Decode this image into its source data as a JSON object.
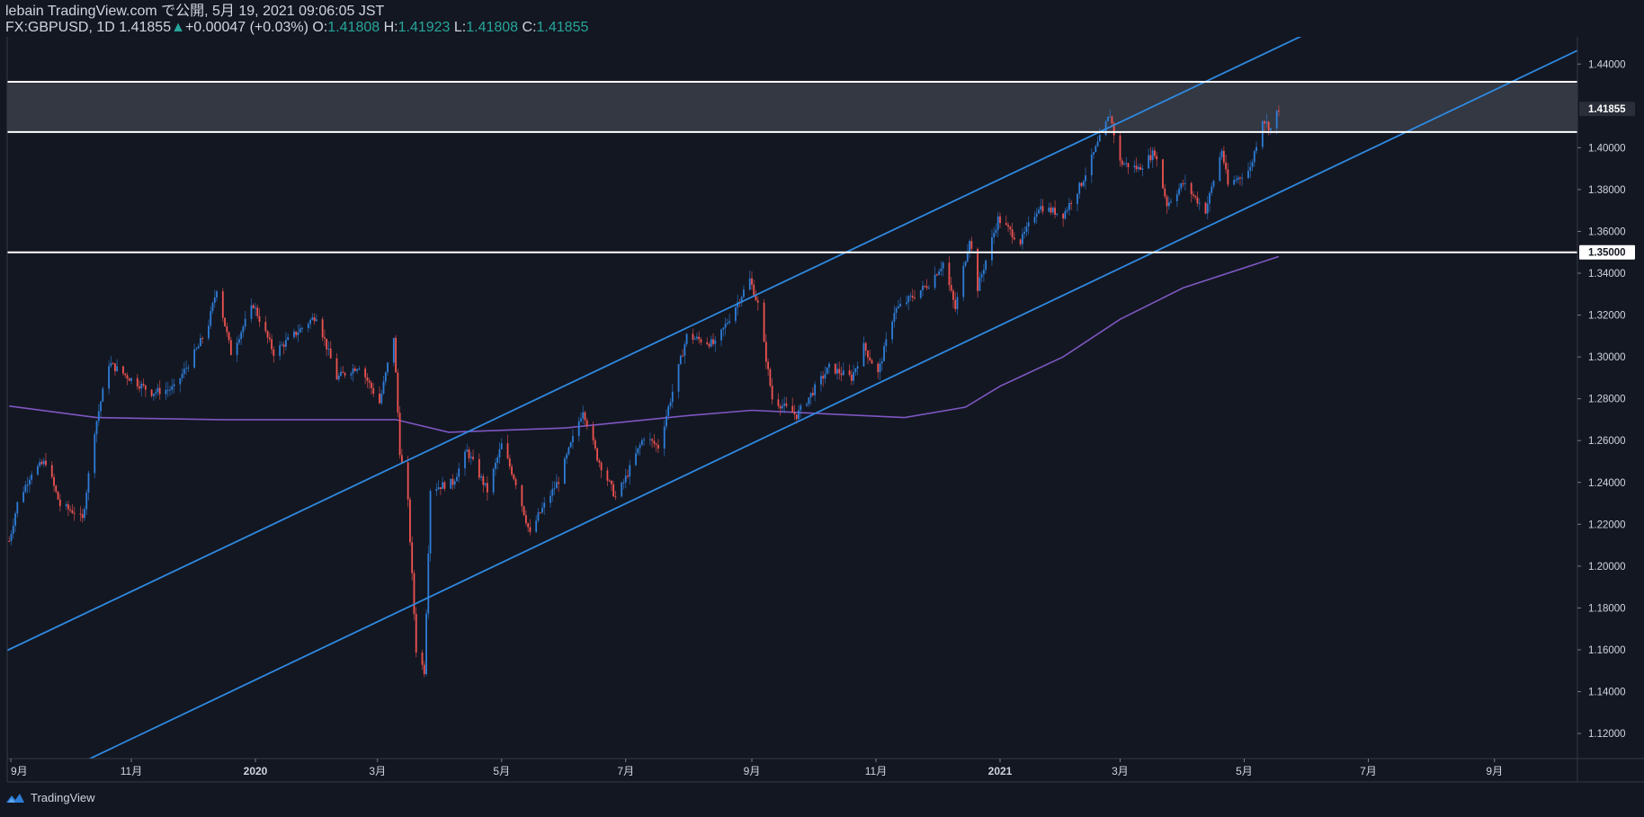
{
  "header": {
    "line1": "lebain TradingView.com で公開, 5月 19, 2021 09:06:05 JST",
    "symbol": "FX:GBPUSD, 1D",
    "last": "1.41855",
    "change": "+0.00047 (+0.03%)",
    "o_label": "O:",
    "o_value": "1.41808",
    "h_label": "H:",
    "h_value": "1.41923",
    "l_label": "L:",
    "l_value": "1.41808",
    "c_label": "C:",
    "c_value": "1.41855"
  },
  "footer": {
    "brand": "TradingView",
    "logo_icon": "tradingview-logo-icon"
  },
  "colors": {
    "background": "#131722",
    "up": "#2e7dd7",
    "down": "#ef5350",
    "channel": "#2f89e0",
    "ma": "#7e57c2",
    "level": "#ffffff",
    "zone": "#3a3e49",
    "text": "#d1d4dc",
    "change": "#26a69a"
  },
  "chart_data": {
    "type": "candlestick",
    "symbol": "FX:GBPUSD",
    "interval": "1D",
    "x_tick_labels": [
      "9月",
      "11月",
      "2020",
      "3月",
      "5月",
      "7月",
      "9月",
      "11月",
      "2021",
      "3月",
      "5月",
      "7月",
      "9月"
    ],
    "y_tick_labels": [
      "1.44000",
      "1.40000",
      "1.38000",
      "1.36000",
      "1.34000",
      "1.32000",
      "1.30000",
      "1.28000",
      "1.26000",
      "1.24000",
      "1.22000",
      "1.20000",
      "1.18000",
      "1.16000",
      "1.14000",
      "1.12000"
    ],
    "ylim": [
      1.108,
      1.453
    ],
    "last_price_label": "1.41855",
    "level_label": "1.35000",
    "horizontal_levels": [
      1.35,
      1.4075,
      1.4315
    ],
    "resistance_zone": [
      1.4075,
      1.4315
    ],
    "price_path": [
      {
        "t": "2019-09-02",
        "v": 1.212
      },
      {
        "t": "2019-09-06",
        "v": 1.23
      },
      {
        "t": "2019-09-13",
        "v": 1.245
      },
      {
        "t": "2019-09-20",
        "v": 1.25
      },
      {
        "t": "2019-09-27",
        "v": 1.229
      },
      {
        "t": "2019-10-04",
        "v": 1.226
      },
      {
        "t": "2019-10-08",
        "v": 1.222
      },
      {
        "t": "2019-10-14",
        "v": 1.265
      },
      {
        "t": "2019-10-21",
        "v": 1.297
      },
      {
        "t": "2019-10-31",
        "v": 1.29
      },
      {
        "t": "2019-11-11",
        "v": 1.283
      },
      {
        "t": "2019-11-22",
        "v": 1.285
      },
      {
        "t": "2019-12-04",
        "v": 1.305
      },
      {
        "t": "2019-12-09",
        "v": 1.316
      },
      {
        "t": "2019-12-13",
        "v": 1.333
      },
      {
        "t": "2019-12-20",
        "v": 1.302
      },
      {
        "t": "2019-12-31",
        "v": 1.325
      },
      {
        "t": "2020-01-10",
        "v": 1.302
      },
      {
        "t": "2020-01-31",
        "v": 1.32
      },
      {
        "t": "2020-02-10",
        "v": 1.29
      },
      {
        "t": "2020-02-21",
        "v": 1.296
      },
      {
        "t": "2020-03-02",
        "v": 1.278
      },
      {
        "t": "2020-03-09",
        "v": 1.31
      },
      {
        "t": "2020-03-12",
        "v": 1.255
      },
      {
        "t": "2020-03-16",
        "v": 1.23
      },
      {
        "t": "2020-03-20",
        "v": 1.16
      },
      {
        "t": "2020-03-24",
        "v": 1.15
      },
      {
        "t": "2020-03-27",
        "v": 1.237
      },
      {
        "t": "2020-04-07",
        "v": 1.24
      },
      {
        "t": "2020-04-14",
        "v": 1.255
      },
      {
        "t": "2020-04-24",
        "v": 1.236
      },
      {
        "t": "2020-05-01",
        "v": 1.258
      },
      {
        "t": "2020-05-08",
        "v": 1.24
      },
      {
        "t": "2020-05-15",
        "v": 1.215
      },
      {
        "t": "2020-05-19",
        "v": 1.224
      },
      {
        "t": "2020-05-29",
        "v": 1.241
      },
      {
        "t": "2020-06-10",
        "v": 1.275
      },
      {
        "t": "2020-06-17",
        "v": 1.252
      },
      {
        "t": "2020-06-26",
        "v": 1.233
      },
      {
        "t": "2020-06-30",
        "v": 1.24
      },
      {
        "t": "2020-07-10",
        "v": 1.262
      },
      {
        "t": "2020-07-17",
        "v": 1.257
      },
      {
        "t": "2020-07-31",
        "v": 1.31
      },
      {
        "t": "2020-08-14",
        "v": 1.306
      },
      {
        "t": "2020-08-31",
        "v": 1.337
      },
      {
        "t": "2020-09-04",
        "v": 1.325
      },
      {
        "t": "2020-09-11",
        "v": 1.28
      },
      {
        "t": "2020-09-23",
        "v": 1.272
      },
      {
        "t": "2020-10-09",
        "v": 1.295
      },
      {
        "t": "2020-10-20",
        "v": 1.29
      },
      {
        "t": "2020-10-26",
        "v": 1.305
      },
      {
        "t": "2020-11-02",
        "v": 1.292
      },
      {
        "t": "2020-11-10",
        "v": 1.322
      },
      {
        "t": "2020-11-27",
        "v": 1.335
      },
      {
        "t": "2020-12-04",
        "v": 1.345
      },
      {
        "t": "2020-12-10",
        "v": 1.323
      },
      {
        "t": "2020-12-17",
        "v": 1.357
      },
      {
        "t": "2020-12-21",
        "v": 1.333
      },
      {
        "t": "2020-12-31",
        "v": 1.366
      },
      {
        "t": "2021-01-11",
        "v": 1.355
      },
      {
        "t": "2021-01-20",
        "v": 1.372
      },
      {
        "t": "2021-02-01",
        "v": 1.368
      },
      {
        "t": "2021-02-10",
        "v": 1.383
      },
      {
        "t": "2021-02-24",
        "v": 1.416
      },
      {
        "t": "2021-03-01",
        "v": 1.393
      },
      {
        "t": "2021-03-10",
        "v": 1.39
      },
      {
        "t": "2021-03-18",
        "v": 1.398
      },
      {
        "t": "2021-03-24",
        "v": 1.373
      },
      {
        "t": "2021-04-01",
        "v": 1.383
      },
      {
        "t": "2021-04-12",
        "v": 1.37
      },
      {
        "t": "2021-04-20",
        "v": 1.399
      },
      {
        "t": "2021-04-23",
        "v": 1.382
      },
      {
        "t": "2021-05-04",
        "v": 1.39
      },
      {
        "t": "2021-05-10",
        "v": 1.414
      },
      {
        "t": "2021-05-14",
        "v": 1.409
      },
      {
        "t": "2021-05-18",
        "v": 1.419
      }
    ],
    "moving_average": [
      {
        "t": "2019-09-02",
        "v": 1.2765
      },
      {
        "t": "2019-10-15",
        "v": 1.271
      },
      {
        "t": "2019-12-15",
        "v": 1.27
      },
      {
        "t": "2020-02-15",
        "v": 1.27
      },
      {
        "t": "2020-03-10",
        "v": 1.27
      },
      {
        "t": "2020-04-05",
        "v": 1.264
      },
      {
        "t": "2020-06-01",
        "v": 1.266
      },
      {
        "t": "2020-08-01",
        "v": 1.272
      },
      {
        "t": "2020-09-01",
        "v": 1.2745
      },
      {
        "t": "2020-11-15",
        "v": 1.271
      },
      {
        "t": "2020-12-15",
        "v": 1.276
      },
      {
        "t": "2021-01-01",
        "v": 1.286
      },
      {
        "t": "2021-02-01",
        "v": 1.3
      },
      {
        "t": "2021-03-01",
        "v": 1.318
      },
      {
        "t": "2021-04-01",
        "v": 1.333
      },
      {
        "t": "2021-05-18",
        "v": 1.348
      }
    ],
    "channel_lines": [
      {
        "name": "upper",
        "from": {
          "t": "2019-09-01",
          "v": 1.1597
        },
        "to": {
          "t": "2021-06-03",
          "v": 1.4556
        }
      },
      {
        "name": "lower",
        "from": {
          "t": "2019-10-21",
          "v": 1.1123
        },
        "to": {
          "t": "2021-10-25",
          "v": 1.4526
        }
      }
    ]
  }
}
